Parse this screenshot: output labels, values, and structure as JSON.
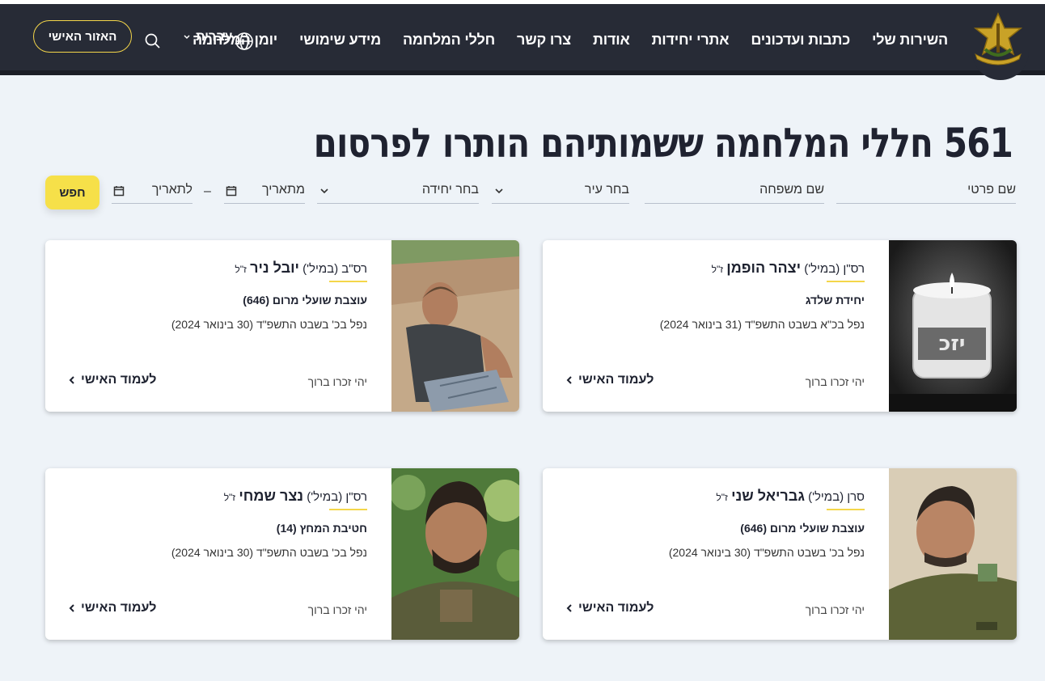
{
  "header": {
    "nav": [
      "השירות שלי",
      "כתבות ועדכונים",
      "אתרי יחידות",
      "אודות",
      "צרו קשר",
      "חללי המלחמה",
      "מידע שימושי",
      "יומן המלחמה"
    ],
    "language": "עברית",
    "personal_area": "האזור האישי",
    "logo_icon": "idf-emblem-icon"
  },
  "page": {
    "title": "561 חללי המלחמה ששמותיהם הותרו לפרסום"
  },
  "filters": {
    "first_name": "שם פרטי",
    "last_name": "שם משפחה",
    "city": "בחר עיר",
    "unit": "בחר יחידה",
    "from_date": "מתאריך",
    "range_sep": "–",
    "to_date": "לתאריך",
    "search": "חפש"
  },
  "colors": {
    "header_bg": "#272b36",
    "accent": "#f4d64a",
    "page_bg": "#eef3f8"
  },
  "cards": [
    {
      "rank": "רס\"ן (במיל')",
      "name": "יצהר הופמן",
      "suffix": "ז\"ל",
      "unit": "יחידת שלדג",
      "fell": "נפל בכ\"א בשבט התשפ\"ד (31 בינואר 2024)",
      "memory": "יהי זכרו ברוך",
      "link": "לעמוד האישי",
      "photo": "memorial-candle"
    },
    {
      "rank": "רס\"ב (במיל')",
      "name": "יובל ניר",
      "suffix": "ז\"ל",
      "unit": "עוצבת שועלי מרום (646)",
      "fell": "נפל בכ' בשבט התשפ\"ד (30 בינואר 2024)",
      "memory": "יהי זכרו ברוך",
      "link": "לעמוד האישי",
      "photo": "portrait"
    },
    {
      "rank": "סרן (במיל')",
      "name": "גבריאל שני",
      "suffix": "ז\"ל",
      "unit": "עוצבת שועלי מרום (646)",
      "fell": "נפל בכ' בשבט התשפ\"ד (30 בינואר 2024)",
      "memory": "יהי זכרו ברוך",
      "link": "לעמוד האישי",
      "photo": "portrait"
    },
    {
      "rank": "רס\"ן (במיל')",
      "name": "נצר שמחי",
      "suffix": "ז\"ל",
      "unit": "חטיבת המחץ (14)",
      "fell": "נפל בכ' בשבט התשפ\"ד (30 בינואר 2024)",
      "memory": "יהי זכרו ברוך",
      "link": "לעמוד האישי",
      "photo": "portrait"
    }
  ]
}
